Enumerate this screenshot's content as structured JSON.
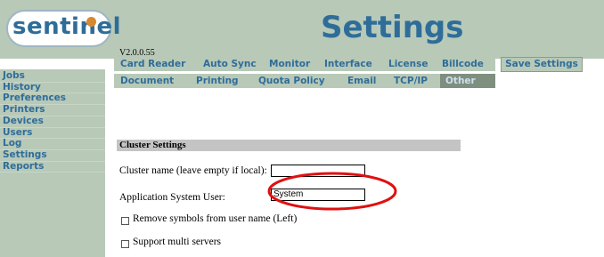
{
  "app": {
    "logo_text": "sentinel",
    "page_title": "Settings",
    "version": "V2.0.0.55"
  },
  "sidebar": {
    "items": [
      {
        "label": "Jobs"
      },
      {
        "label": "History"
      },
      {
        "label": "Preferences"
      },
      {
        "label": "Printers"
      },
      {
        "label": "Devices"
      },
      {
        "label": "Users"
      },
      {
        "label": "Log"
      },
      {
        "label": "Settings"
      },
      {
        "label": "Reports"
      }
    ]
  },
  "tabs": {
    "row1": [
      {
        "label": "Card Reader"
      },
      {
        "label": "Auto Sync"
      },
      {
        "label": "Monitor"
      },
      {
        "label": "Interface"
      },
      {
        "label": "License"
      },
      {
        "label": "Billcode"
      }
    ],
    "row2": [
      {
        "label": "Document"
      },
      {
        "label": "Printing"
      },
      {
        "label": "Quota Policy"
      },
      {
        "label": "Email"
      },
      {
        "label": "TCP/IP"
      },
      {
        "label": "Other",
        "active": true
      }
    ]
  },
  "toolbar": {
    "save_label": "Save Settings"
  },
  "cluster": {
    "section_title": "Cluster Settings",
    "cluster_name_label": "Cluster name (leave empty if local):",
    "cluster_name_value": "",
    "app_user_label": "Application System User:",
    "app_user_value": "System",
    "remove_symbols_label": "Remove symbols from user name (Left)",
    "remove_symbols_checked": false,
    "multi_servers_label": "Support multi servers",
    "multi_servers_checked": false
  },
  "colors": {
    "bar": "#b8c9b8",
    "link": "#2f6d99",
    "active_tab": "#7f8f7f",
    "annotation": "#e01010",
    "logo_accent": "#d8892e"
  }
}
